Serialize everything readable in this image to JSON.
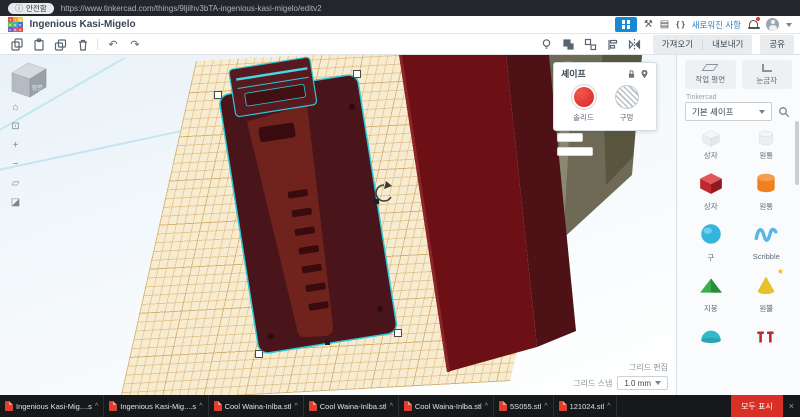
{
  "colors": {
    "accent_blue": "#1789d6",
    "selection_teal": "#2bc8da",
    "solid_red": "#d21f20",
    "object_maroon": "#6c1016",
    "workplane_tan": "#f8ecd0",
    "download_red": "#e33d2e",
    "showall_red": "#d93025"
  },
  "icons": {
    "info": "ⓘ",
    "pickaxe": "⚒",
    "bricks": "▤",
    "braces": "{ }",
    "home": "⌂",
    "fit": "⊡",
    "zoom_in": "+",
    "zoom_out": "−",
    "ortho": "▱",
    "persp": "◪",
    "undo": "↶",
    "redo": "↷",
    "caret_up": "^",
    "close": "×",
    "star": "★"
  },
  "browser": {
    "security_badge": "안전함",
    "url": "https://www.tinkercad.com/things/9ljilhv3bTA-ingenious-kasi-migelo/editv2"
  },
  "header": {
    "logo_letters": [
      "T",
      "I",
      "N",
      "K",
      "E",
      "R",
      "C",
      "A",
      "D"
    ],
    "title": "Ingenious Kasi-Migelo",
    "whats_new": "새로워진 사항"
  },
  "toolbar": {
    "import_label": "가져오기",
    "export_label": "내보내기",
    "share_label": "공유"
  },
  "viewcube": {
    "front_label": "정면"
  },
  "canvas": {
    "shape_panel": {
      "title": "셰이프",
      "solid_label": "솔리드",
      "hole_label": "구멍"
    },
    "grid_controls": {
      "edit_label": "그리드 편집",
      "snap_label": "그리드 스냅",
      "snap_value": "1.0 mm"
    }
  },
  "sidebar": {
    "workplane_label": "작업 평면",
    "ruler_label": "눈금자",
    "brand": "Tinkercad",
    "category": "기본 셰이프",
    "shapes": [
      {
        "name": "상자"
      },
      {
        "name": "원통"
      },
      {
        "name": "상자"
      },
      {
        "name": "원통"
      },
      {
        "name": "구"
      },
      {
        "name": "Scribble"
      },
      {
        "name": "지붕"
      },
      {
        "name": "원뿔"
      },
      {
        "name": ""
      },
      {
        "name": ""
      }
    ]
  },
  "downloads": {
    "items": [
      "Ingenious Kasi-Mig....stl",
      "Ingenious Kasi-Mig....stl",
      "Cool Waina-Inlba.stl",
      "Cool Waina-Inlba.stl",
      "Cool Waina-Inlba.stl",
      "5S055.stl",
      "121024.stl"
    ],
    "show_all": "모두 표시"
  }
}
